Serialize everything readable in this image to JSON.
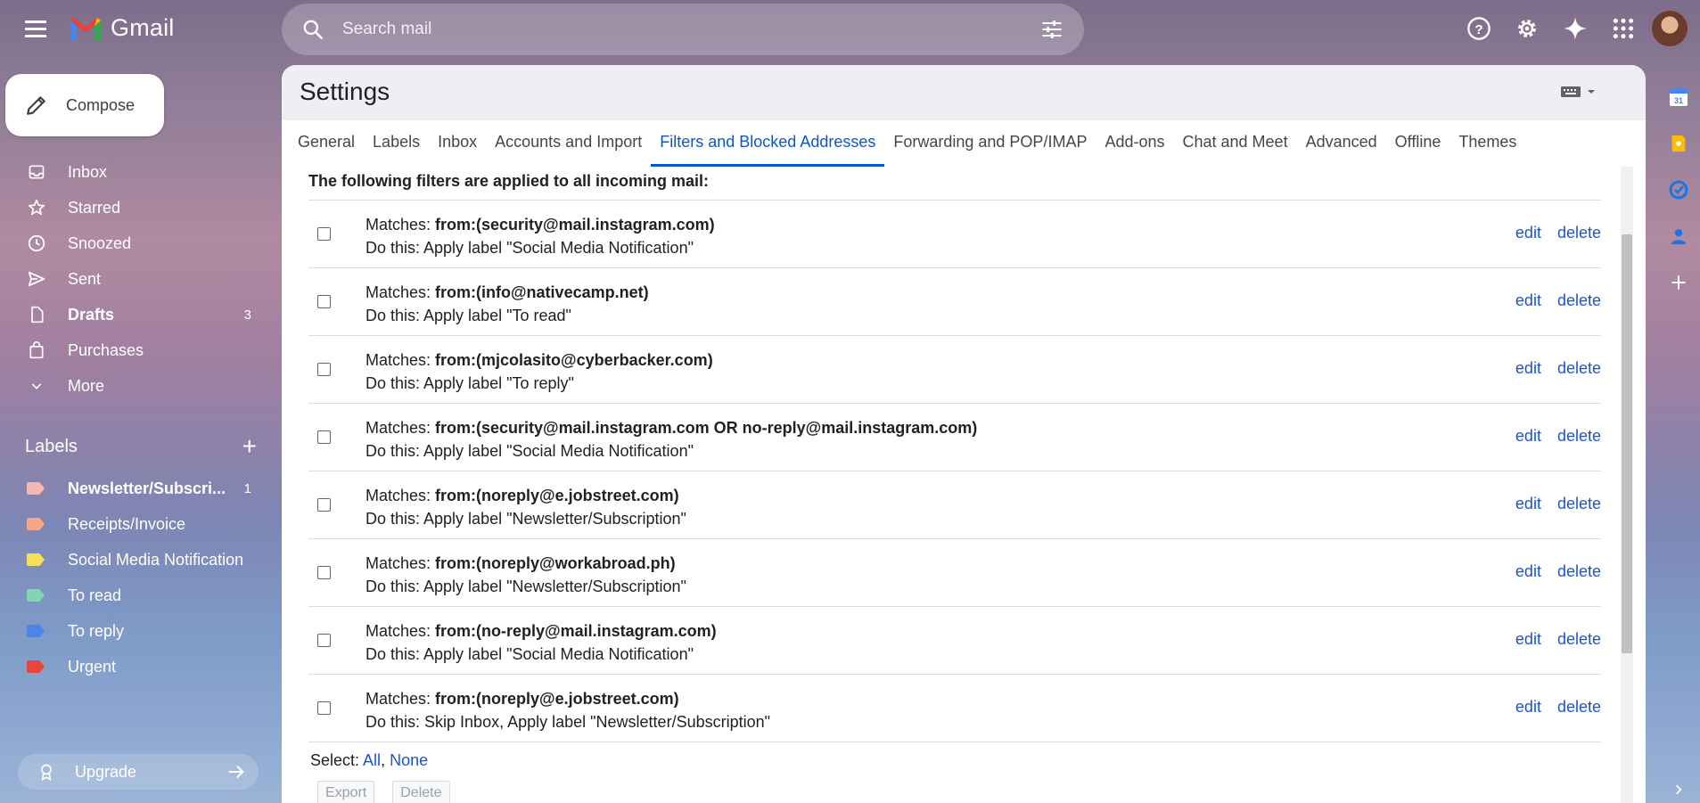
{
  "app": {
    "name": "Gmail",
    "search_placeholder": "Search mail"
  },
  "compose": {
    "label": "Compose"
  },
  "nav": [
    {
      "label": "Inbox",
      "icon": "inbox-icon",
      "count": ""
    },
    {
      "label": "Starred",
      "icon": "star-icon",
      "count": ""
    },
    {
      "label": "Snoozed",
      "icon": "clock-icon",
      "count": ""
    },
    {
      "label": "Sent",
      "icon": "send-icon",
      "count": ""
    },
    {
      "label": "Drafts",
      "icon": "draft-icon",
      "count": "3"
    },
    {
      "label": "Purchases",
      "icon": "shopping-bag-icon",
      "count": ""
    },
    {
      "label": "More",
      "icon": "chevron-down-icon",
      "count": ""
    }
  ],
  "labels_section": {
    "title": "Labels",
    "items": [
      {
        "name": "Newsletter/Subscri...",
        "color": "#f5b8b0",
        "count": "1"
      },
      {
        "name": "Receipts/Invoice",
        "color": "#f6a58a",
        "count": ""
      },
      {
        "name": "Social Media Notification",
        "color": "#f6e05a",
        "count": ""
      },
      {
        "name": "To read",
        "color": "#7fd6b0",
        "count": ""
      },
      {
        "name": "To reply",
        "color": "#4a86e8",
        "count": ""
      },
      {
        "name": "Urgent",
        "color": "#e8453c",
        "count": ""
      }
    ]
  },
  "upgrade": {
    "label": "Upgrade"
  },
  "settings": {
    "title": "Settings",
    "tabs": [
      "General",
      "Labels",
      "Inbox",
      "Accounts and Import",
      "Filters and Blocked Addresses",
      "Forwarding and POP/IMAP",
      "Add-ons",
      "Chat and Meet",
      "Advanced",
      "Offline",
      "Themes"
    ],
    "active_tab": "Filters and Blocked Addresses",
    "intro": "The following filters are applied to all incoming mail:",
    "matches_prefix": "Matches: ",
    "do_prefix": "Do this: ",
    "edit_label": "edit",
    "delete_label": "delete",
    "filters": [
      {
        "match": "from:(security@mail.instagram.com)",
        "action": "Apply label \"Social Media Notification\""
      },
      {
        "match": "from:(info@nativecamp.net)",
        "action": "Apply label \"To read\""
      },
      {
        "match": "from:(mjcolasito@cyberbacker.com)",
        "action": "Apply label \"To reply\""
      },
      {
        "match": "from:(security@mail.instagram.com OR no-reply@mail.instagram.com)",
        "action": "Apply label \"Social Media Notification\""
      },
      {
        "match": "from:(noreply@e.jobstreet.com)",
        "action": "Apply label \"Newsletter/Subscription\""
      },
      {
        "match": "from:(noreply@workabroad.ph)",
        "action": "Apply label \"Newsletter/Subscription\""
      },
      {
        "match": "from:(no-reply@mail.instagram.com)",
        "action": "Apply label \"Social Media Notification\""
      },
      {
        "match": "from:(noreply@e.jobstreet.com)",
        "action": "Skip Inbox, Apply label \"Newsletter/Subscription\""
      }
    ],
    "select_prefix": "Select: ",
    "select_all": "All",
    "select_none": "None",
    "export_label": "Export",
    "delete_button_label": "Delete"
  }
}
